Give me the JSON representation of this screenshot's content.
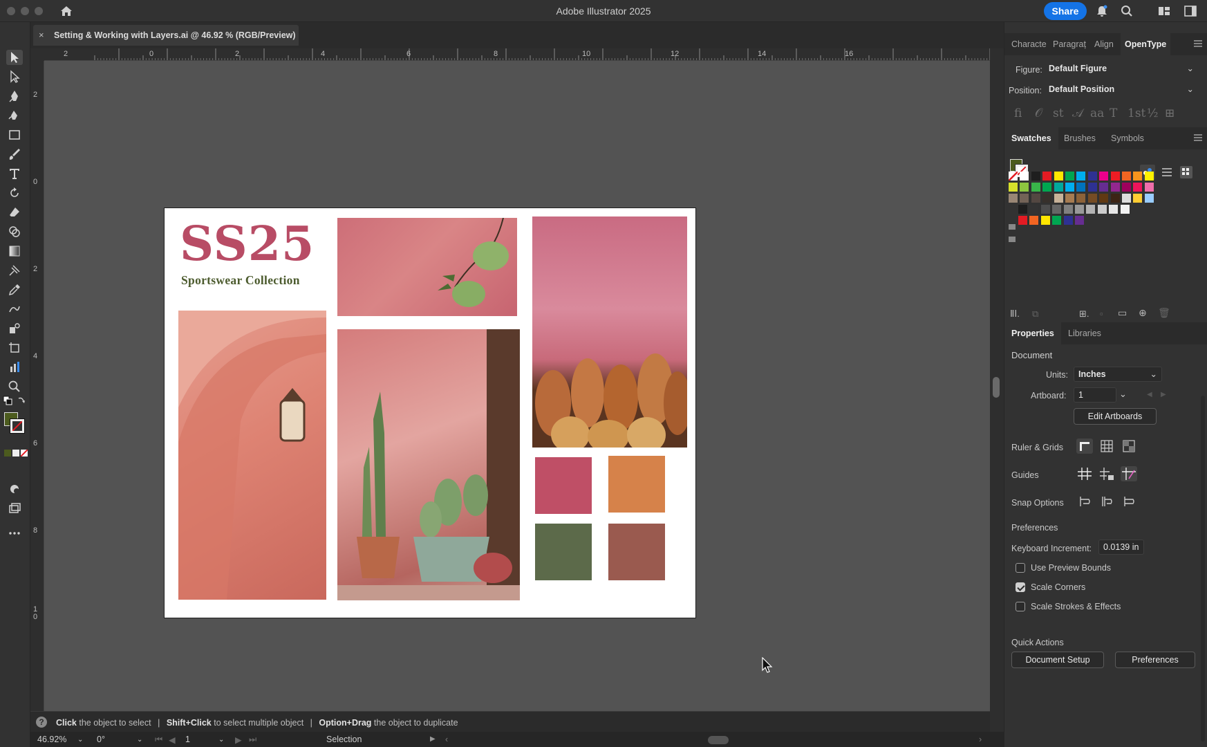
{
  "app": {
    "title": "Adobe Illustrator 2025",
    "share_label": "Share"
  },
  "document_tab": {
    "close_glyph": "×",
    "title": "Setting & Working with Layers.ai @ 46.92 % (RGB/Preview)"
  },
  "ruler": {
    "top_labels": [
      "2",
      "0",
      "2",
      "4",
      "6",
      "8",
      "10",
      "12",
      "14",
      "16"
    ],
    "left_labels": [
      "2",
      "0",
      "2",
      "4",
      "6",
      "8",
      "1\n0"
    ]
  },
  "artboard": {
    "title": "SS25",
    "subtitle": "Sportswear Collection",
    "palette": [
      "#bf4f66",
      "#d6824a",
      "#5c6a4a",
      "#9a5a4f"
    ]
  },
  "hint": {
    "help_glyph": "?",
    "parts": [
      {
        "bold": "Click",
        "text": " the object to select"
      },
      {
        "bold": "Shift+Click",
        "text": " to select multiple object"
      },
      {
        "bold": "Option+Drag",
        "text": " the object to duplicate"
      }
    ],
    "separator": "|"
  },
  "status": {
    "zoom": "46.92%",
    "rotation": "0°",
    "artboard": "1",
    "tool": "Selection"
  },
  "opentype_panel": {
    "tabs": [
      "Characte",
      "Paragraț",
      "Align",
      "OpenType"
    ],
    "figure_label": "Figure:",
    "figure_value": "Default Figure",
    "position_label": "Position:",
    "position_value": "Default Position",
    "glyphs": [
      "ﬁ",
      "𝒪",
      "st",
      "𝒜",
      "aa",
      "T",
      "1st",
      "½",
      "⊞"
    ]
  },
  "swatches_panel": {
    "tabs": [
      "Swatches",
      "Brushes",
      "Symbols"
    ],
    "fill_color": "#4c5b1e",
    "rows": [
      [
        "#ffffff",
        "#ffffff",
        "#1e1e1e",
        "#e31b23",
        "#ffe600",
        "#00a651",
        "#00aeef",
        "#2e3192",
        "#ec008c",
        "#ed1c24",
        "#f26522",
        "#f7941d",
        "#fff200"
      ],
      [
        "#d7e02b",
        "#8dc63f",
        "#39b54a",
        "#00a650",
        "#00a99d",
        "#00aeef",
        "#0072bc",
        "#2e3192",
        "#662d91",
        "#92278f",
        "#9e005d",
        "#ed145b",
        "#f06eaa"
      ],
      [
        "#998675",
        "#736357",
        "#534741",
        "#37302b",
        "#c7b299",
        "#a67c52",
        "#8c6239",
        "#754c24",
        "#603913",
        "#3c2415",
        "#dddddd",
        "#ffcc33",
        "#99ccff"
      ],
      [
        "#1e1e1e",
        "#333333",
        "#4d4d4d",
        "#666666",
        "#808080",
        "#999999",
        "#b3b3b3",
        "#cccccc",
        "#e6e6e6",
        "#f2f2f2"
      ],
      [
        "#e31b23",
        "#f26522",
        "#ffe600",
        "#00a651",
        "#2e3192",
        "#662d91"
      ]
    ]
  },
  "properties_panel": {
    "tabs": [
      "Properties",
      "Libraries"
    ],
    "document_heading": "Document",
    "units_label": "Units:",
    "units_value": "Inches",
    "artboard_label": "Artboard:",
    "artboard_value": "1",
    "edit_artboards": "Edit Artboards",
    "ruler_grids": "Ruler & Grids",
    "guides": "Guides",
    "snap_options": "Snap Options",
    "preferences_heading": "Preferences",
    "keyboard_increment_label": "Keyboard Increment:",
    "keyboard_increment_value": "0.0139 in",
    "checkboxes": [
      {
        "label": "Use Preview Bounds",
        "checked": false
      },
      {
        "label": "Scale Corners",
        "checked": true
      },
      {
        "label": "Scale Strokes & Effects",
        "checked": false
      }
    ],
    "quick_actions_heading": "Quick Actions",
    "document_setup": "Document Setup",
    "preferences_button": "Preferences"
  }
}
